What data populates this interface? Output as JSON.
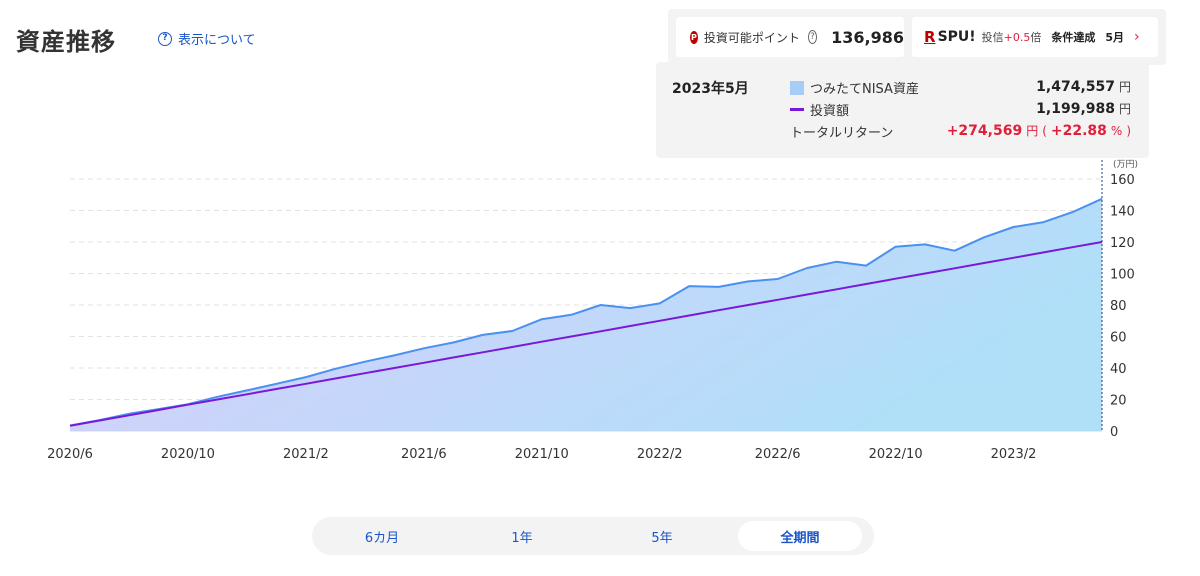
{
  "header": {
    "title": "資産推移",
    "about_link": "表示について",
    "help_symbol": "?"
  },
  "points_card": {
    "icon_letter": "P",
    "label": "投資可能ポイント",
    "help_symbol": "?",
    "value": "136,986"
  },
  "spu_card": {
    "logo_r": "R",
    "logo_text": "SPU!",
    "text_prefix": "投信",
    "text_bonus": "+0.5",
    "text_suffix": "倍",
    "condition": "条件達成",
    "month": "5月",
    "chevron": "›"
  },
  "tooltip": {
    "date": "2023年5月",
    "series1_label": "つみたてNISA資産",
    "series1_value": "1,474,557",
    "series2_label": "投資額",
    "series2_value": "1,199,988",
    "return_label": "トータルリターン",
    "return_value": "+274,569",
    "return_pct_open": "(",
    "return_pct": "+22.88",
    "return_pct_unit": "%",
    "return_pct_close": ")",
    "unit": "円"
  },
  "period_tabs": [
    {
      "label": "6カ月",
      "active": false
    },
    {
      "label": "1年",
      "active": false
    },
    {
      "label": "5年",
      "active": false
    },
    {
      "label": "全期間",
      "active": true
    }
  ],
  "colors": {
    "asset_line": "#4a90f0",
    "investment_line": "#7a18d8",
    "area_top": "#a9d6f7",
    "area_bottom": "#d9c9fb",
    "return_red": "#e0203a",
    "link_blue": "#1a56c9"
  },
  "chart_data": {
    "type": "area",
    "unit_label": "(万円)",
    "ylim": [
      0,
      160
    ],
    "y_ticks": [
      0,
      20,
      40,
      60,
      80,
      100,
      120,
      140,
      160
    ],
    "x_tick_labels": [
      "2020/6",
      "2020/10",
      "2021/2",
      "2021/6",
      "2021/10",
      "2022/2",
      "2022/6",
      "2022/10",
      "2023/2"
    ],
    "x": [
      "2020/6",
      "2020/7",
      "2020/8",
      "2020/9",
      "2020/10",
      "2020/11",
      "2020/12",
      "2021/1",
      "2021/2",
      "2021/3",
      "2021/4",
      "2021/5",
      "2021/6",
      "2021/7",
      "2021/8",
      "2021/9",
      "2021/10",
      "2021/11",
      "2021/12",
      "2022/1",
      "2022/2",
      "2022/3",
      "2022/4",
      "2022/5",
      "2022/6",
      "2022/7",
      "2022/8",
      "2022/9",
      "2022/10",
      "2022/11",
      "2022/12",
      "2023/1",
      "2023/2",
      "2023/3",
      "2023/4",
      "2023/5"
    ],
    "series": [
      {
        "name": "つみたてNISA資産",
        "values": [
          3.5,
          6.9,
          10.9,
          13.9,
          17.0,
          21.7,
          25.8,
          30.0,
          34.2,
          39.5,
          44.0,
          48.0,
          52.5,
          56.2,
          61.0,
          63.5,
          71.0,
          73.8,
          80.0,
          78.0,
          81.0,
          92.0,
          91.5,
          95.0,
          96.5,
          103.5,
          107.5,
          105.0,
          117.0,
          118.5,
          114.5,
          123.0,
          129.5,
          132.5,
          139.0,
          147.4557
        ]
      },
      {
        "name": "投資額",
        "values": [
          3.33,
          6.67,
          10.0,
          13.33,
          16.67,
          20.0,
          23.33,
          26.67,
          30.0,
          33.33,
          36.67,
          40.0,
          43.33,
          46.67,
          50.0,
          53.33,
          56.67,
          60.0,
          63.33,
          66.67,
          70.0,
          73.33,
          76.67,
          80.0,
          83.33,
          86.67,
          90.0,
          93.33,
          96.67,
          100.0,
          103.33,
          106.67,
          110.0,
          113.33,
          116.67,
          119.9988
        ]
      }
    ]
  }
}
